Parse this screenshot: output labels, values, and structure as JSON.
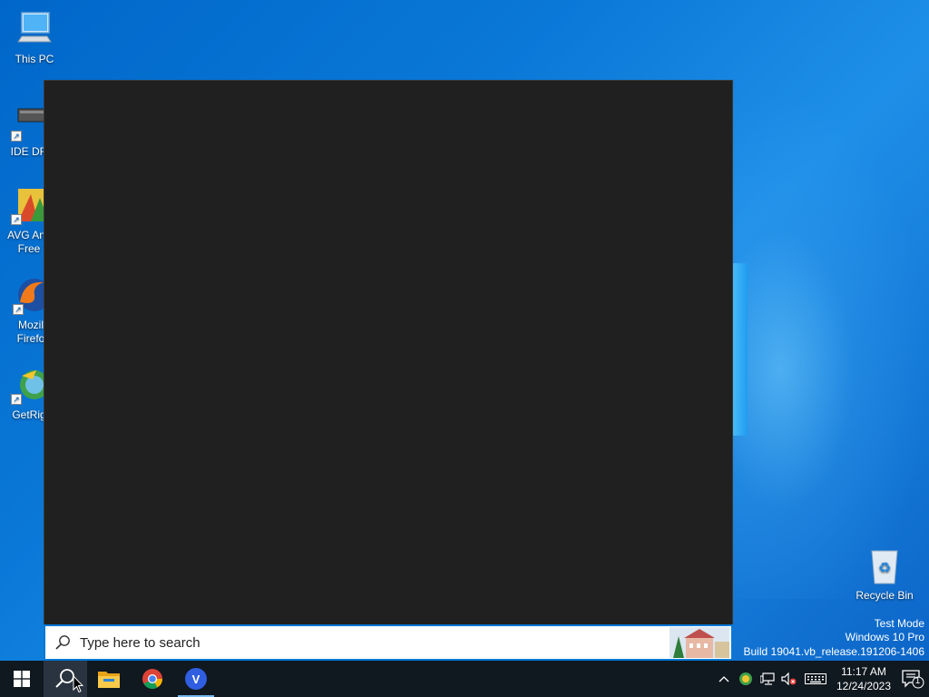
{
  "desktop": {
    "icons": [
      {
        "label": "This PC",
        "icon": "this-pc-icon"
      },
      {
        "label": "IDE DR",
        "icon": "ide-drive-icon"
      },
      {
        "label": "AVG Anti Free",
        "icon": "avg-antivirus-icon"
      },
      {
        "label": "Mozil Firefo",
        "icon": "firefox-icon"
      },
      {
        "label": "GetRig",
        "icon": "getright-icon"
      },
      {
        "label": "Recycle Bin",
        "icon": "recycle-bin-icon"
      }
    ],
    "watermark": {
      "line1": "Test Mode",
      "line2": "Windows 10 Pro",
      "line3": "Build 19041.vb_release.191206-1406"
    }
  },
  "search": {
    "placeholder": "Type here to search",
    "value": ""
  },
  "taskbar": {
    "apps": [
      {
        "name": "Start",
        "icon": "windows-start-icon"
      },
      {
        "name": "Search",
        "icon": "search-icon",
        "active": true
      },
      {
        "name": "File Explorer",
        "icon": "file-explorer-icon"
      },
      {
        "name": "Google Chrome",
        "icon": "chrome-icon"
      },
      {
        "name": "V",
        "icon": "v-app-icon",
        "running": true
      }
    ],
    "tray": {
      "time": "11:17 AM",
      "date": "12/24/2023",
      "notifications": "1"
    }
  },
  "colors": {
    "accent": "#0078d7",
    "panel": "#202020",
    "taskbar": "#101820"
  }
}
